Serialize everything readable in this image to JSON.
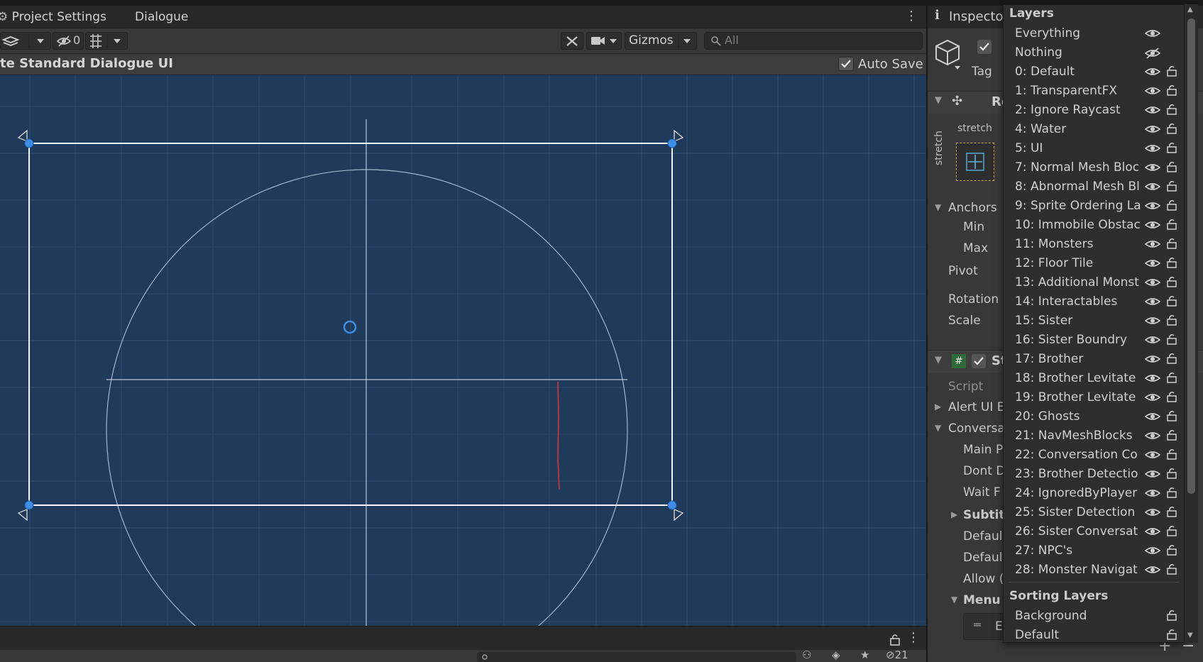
{
  "tabs": {
    "project_settings": "Project Settings",
    "dialogue": "Dialogue"
  },
  "toolbar": {
    "hidden_count": "0",
    "gizmos_label": "Gizmos",
    "search_placeholder": "All"
  },
  "prefab": {
    "title": "te Standard Dialogue UI",
    "auto_save_label": "Auto Save"
  },
  "footer": {
    "hidden_objects_count": "21"
  },
  "inspector": {
    "tab_title": "Inspecto",
    "tag_label": "Tag",
    "rect_header": "Re",
    "stretch_h": "stretch",
    "stretch_v": "stretch",
    "anchors": "Anchors",
    "min": "Min",
    "max": "Max",
    "pivot": "Pivot",
    "rotation": "Rotation",
    "scale": "Scale",
    "script_header": "St",
    "script": "Script",
    "alert": "Alert UI E",
    "conversation": "Conversa",
    "main_p": "Main P",
    "dont_d": "Dont D",
    "wait_f": "Wait F",
    "subtitle": "Subtit",
    "default1": "Defaul",
    "default2": "Defaul",
    "allow": "Allow (",
    "menu": "Menu",
    "element_btn": "E"
  },
  "layers_dropdown": {
    "title": "Layers",
    "items": [
      {
        "label": "Everything",
        "eye": "visible",
        "lock": false
      },
      {
        "label": "Nothing",
        "eye": "hidden",
        "lock": false
      },
      {
        "label": "0: Default",
        "eye": "visible",
        "lock": true
      },
      {
        "label": "1: TransparentFX",
        "eye": "visible",
        "lock": true
      },
      {
        "label": "2: Ignore Raycast",
        "eye": "visible",
        "lock": true
      },
      {
        "label": "4: Water",
        "eye": "visible",
        "lock": true
      },
      {
        "label": "5: UI",
        "eye": "visible",
        "lock": true
      },
      {
        "label": "7: Normal Mesh Bloc",
        "eye": "visible",
        "lock": true
      },
      {
        "label": "8: Abnormal Mesh Bl",
        "eye": "visible",
        "lock": true
      },
      {
        "label": "9: Sprite Ordering La",
        "eye": "visible",
        "lock": true
      },
      {
        "label": "10: Immobile Obstac",
        "eye": "visible",
        "lock": true
      },
      {
        "label": "11: Monsters",
        "eye": "visible",
        "lock": true
      },
      {
        "label": "12: Floor Tile",
        "eye": "visible",
        "lock": true
      },
      {
        "label": "13: Additional Monst",
        "eye": "visible",
        "lock": true
      },
      {
        "label": "14: Interactables",
        "eye": "visible",
        "lock": true
      },
      {
        "label": "15: Sister",
        "eye": "visible",
        "lock": true
      },
      {
        "label": "16: Sister Boundry",
        "eye": "visible",
        "lock": true
      },
      {
        "label": "17: Brother",
        "eye": "visible",
        "lock": true
      },
      {
        "label": "18: Brother Levitate",
        "eye": "visible",
        "lock": true
      },
      {
        "label": "19: Brother Levitate",
        "eye": "visible",
        "lock": true
      },
      {
        "label": "20: Ghosts",
        "eye": "visible",
        "lock": true
      },
      {
        "label": "21: NavMeshBlocks",
        "eye": "visible",
        "lock": true
      },
      {
        "label": "22: Conversation Co",
        "eye": "visible",
        "lock": true
      },
      {
        "label": "23: Brother Detectio",
        "eye": "visible",
        "lock": true
      },
      {
        "label": "24: IgnoredByPlayer",
        "eye": "visible",
        "lock": true
      },
      {
        "label": "25: Sister Detection",
        "eye": "visible",
        "lock": true
      },
      {
        "label": "26: Sister Conversat",
        "eye": "visible",
        "lock": true
      },
      {
        "label": "27: NPC's",
        "eye": "visible",
        "lock": true
      },
      {
        "label": "28: Monster Navigat",
        "eye": "visible",
        "lock": true
      }
    ],
    "sorting_title": "Sorting Layers",
    "sorting_items": [
      {
        "label": "Background",
        "lock": true
      },
      {
        "label": "Default",
        "lock": true
      }
    ]
  }
}
